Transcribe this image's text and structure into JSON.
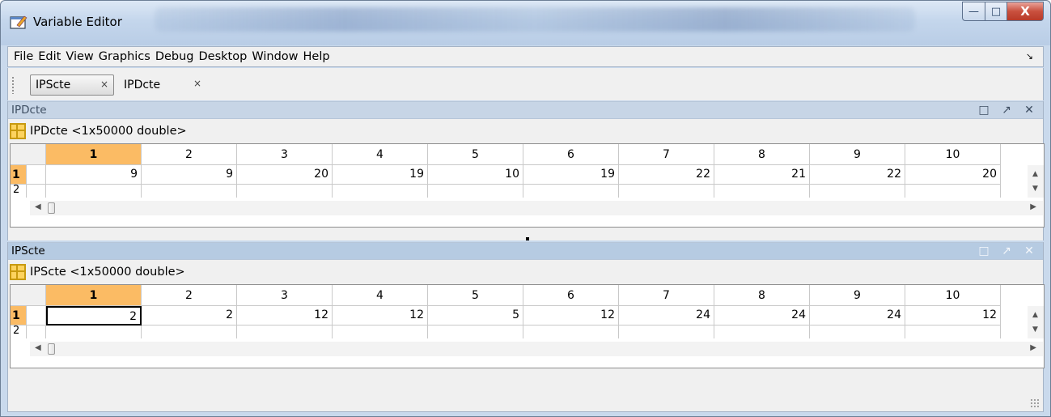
{
  "window": {
    "title": "Variable Editor",
    "caption_buttons": {
      "minimize": "—",
      "maximize": "□",
      "close": "X"
    }
  },
  "menubar": {
    "items": [
      "File",
      "Edit",
      "View",
      "Graphics",
      "Debug",
      "Desktop",
      "Window",
      "Help"
    ],
    "overflow": "↘"
  },
  "tabs": [
    {
      "label": "IPScte",
      "close": "×",
      "active": true
    },
    {
      "label": "IPDcte",
      "close": "×",
      "active": false
    }
  ],
  "panels": [
    {
      "name": "IPDcte",
      "header_title": "IPDcte",
      "header_buttons": {
        "undock": "□",
        "dock": "↗",
        "close": "✕"
      },
      "variable_label": "IPDcte <1x50000 double>",
      "columns": [
        "1",
        "2",
        "3",
        "4",
        "5",
        "6",
        "7",
        "8",
        "9",
        "10"
      ],
      "rows": [
        {
          "label": "1",
          "values": [
            "9",
            "9",
            "20",
            "19",
            "10",
            "19",
            "22",
            "21",
            "22",
            "20"
          ]
        },
        {
          "label": "2"
        }
      ]
    },
    {
      "name": "IPScte",
      "header_title": "IPScte",
      "header_buttons": {
        "undock": "□",
        "dock": "↗",
        "close": "✕"
      },
      "variable_label": "IPScte <1x50000 double>",
      "columns": [
        "1",
        "2",
        "3",
        "4",
        "5",
        "6",
        "7",
        "8",
        "9",
        "10"
      ],
      "rows": [
        {
          "label": "1",
          "values": [
            "2",
            "2",
            "12",
            "12",
            "5",
            "12",
            "24",
            "24",
            "24",
            "12"
          ]
        },
        {
          "label": "2"
        }
      ]
    }
  ],
  "scroll": {
    "up": "▲",
    "down": "▼",
    "left": "◀",
    "right": "▶"
  },
  "colors": {
    "selected_header": "#fbbb64",
    "panel_active": "#c7d5e6",
    "panel_inactive": "#b6cbe2"
  },
  "icons": [
    "app-window-icon",
    "grid-variable-icon"
  ]
}
